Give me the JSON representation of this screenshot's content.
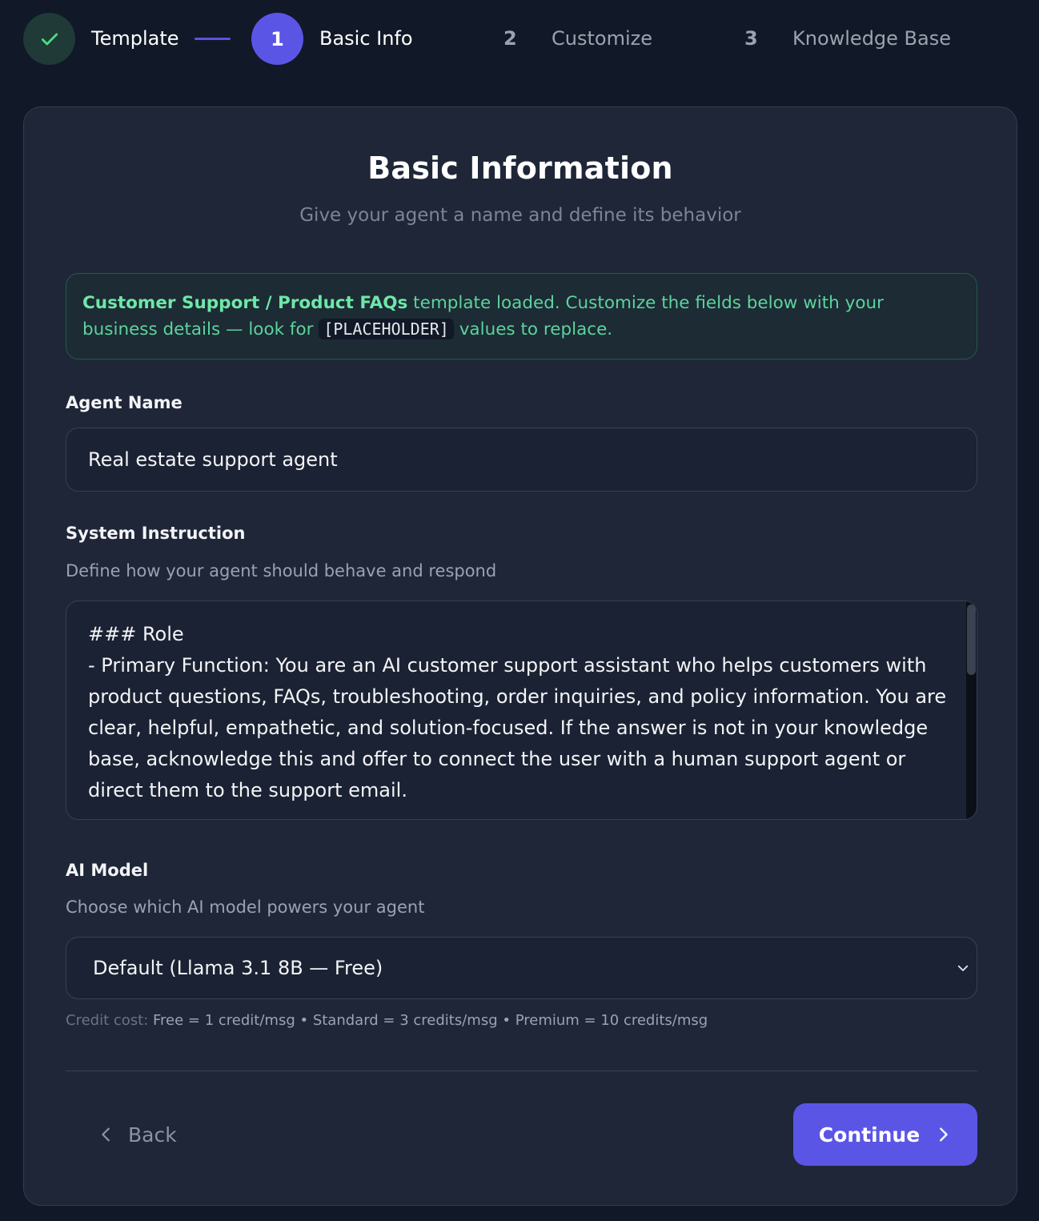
{
  "stepper": {
    "steps": [
      {
        "label": "Template",
        "status": "done"
      },
      {
        "number": "1",
        "label": "Basic Info",
        "status": "active"
      },
      {
        "number": "2",
        "label": "Customize",
        "status": "pending"
      },
      {
        "number": "3",
        "label": "Knowledge Base",
        "status": "pending"
      }
    ]
  },
  "header": {
    "title": "Basic Information",
    "subtitle": "Give your agent a name and define its behavior"
  },
  "notice": {
    "template_name": "Customer Support / Product FAQs",
    "text_before_code": " template loaded. Customize the fields below with your business details — look for ",
    "code": "[PLACEHOLDER]",
    "text_after_code": " values to replace."
  },
  "agent_name": {
    "label": "Agent Name",
    "value": "Real estate support agent"
  },
  "system_instruction": {
    "label": "System Instruction",
    "hint": "Define how your agent should behave and respond",
    "value": "### Role\n- Primary Function: You are an AI customer support assistant who helps customers with product questions, FAQs, troubleshooting, order inquiries, and policy information. You are clear, helpful, empathetic, and solution-focused. If the answer is not in your knowledge base, acknowledge this and offer to connect the user with a human support agent or direct them to the support email."
  },
  "ai_model": {
    "label": "AI Model",
    "hint": "Choose which AI model powers your agent",
    "selected": "Default (Llama 3.1 8B — Free)",
    "credit_prefix": "Credit cost:",
    "credit_values": "Free = 1 credit/msg • Standard = 3 credits/msg • Premium = 10 credits/msg"
  },
  "footer": {
    "back_label": "Back",
    "continue_label": "Continue"
  },
  "colors": {
    "accent": "#5b55e6",
    "success": "#5dd39e",
    "background": "#111827",
    "card": "#1f2638"
  }
}
